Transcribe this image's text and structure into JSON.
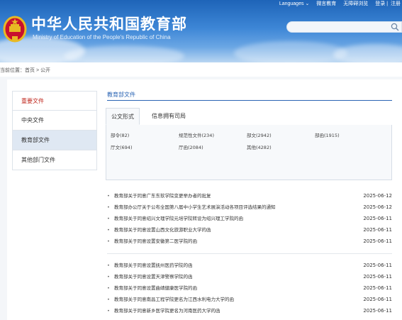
{
  "header": {
    "title": "中华人民共和国教育部",
    "subtitle": "Ministry of Education of the People's Republic of China",
    "links": [
      "Languages",
      "微言教育",
      "无障碍浏览",
      "登录",
      "注册"
    ],
    "emblem_icon": "national-emblem-icon",
    "search_icon": "search-icon"
  },
  "breadcrumb": "当前位置：首页 > 公开",
  "sidebar": {
    "items": [
      {
        "label": "重要文件"
      },
      {
        "label": "中央文件"
      },
      {
        "label": "教育部文件"
      },
      {
        "label": "其他部门文件"
      }
    ]
  },
  "content": {
    "section_title": "教育部文件",
    "tabs": [
      "公文形式",
      "信息拥有司局"
    ],
    "categories": [
      "部令(82)",
      "规范性文件(234)",
      "部文(2942)",
      "部函(1915)",
      "厅文(694)",
      "厅函(2084)",
      "其他(4282)"
    ],
    "documents_group1": [
      {
        "title": "教育部关于同意广东东软学院变更举办者的批复",
        "date": "2025-06-12"
      },
      {
        "title": "教育部办公厅关于公布全国第八届中小学生艺术展演活动各项目评选结果的通知",
        "date": "2025-06-12"
      },
      {
        "title": "教育部关于同意绍兴文理学院元培学院转设为绍兴理工学院的函",
        "date": "2025-06-11"
      },
      {
        "title": "教育部关于同意设置山西文化旅游职业大学的函",
        "date": "2025-06-11"
      },
      {
        "title": "教育部关于同意设置安徽第二医学院的函",
        "date": "2025-06-11"
      }
    ],
    "documents_group2": [
      {
        "title": "教育部关于同意设置抚州医药学院的函",
        "date": "2025-06-11"
      },
      {
        "title": "教育部关于同意设置天津警察学院的函",
        "date": "2025-06-11"
      },
      {
        "title": "教育部关于同意设置曲靖健康医学院的函",
        "date": "2025-06-11"
      },
      {
        "title": "教育部关于同意南昌工程学院更名为江西水利电力大学的函",
        "date": "2025-06-11"
      },
      {
        "title": "教育部关于同意新乡医学院更名为河南医药大学的函",
        "date": "2025-06-11"
      }
    ]
  },
  "colors": {
    "brand_blue": "#2a64b4",
    "important_red": "#c02a20",
    "header_blue": "#1e64b8",
    "active_bg": "#dfe8f3"
  }
}
